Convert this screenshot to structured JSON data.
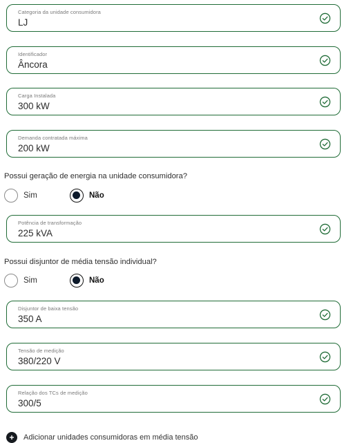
{
  "fields": [
    {
      "label": "Categoria da unidade consumidora",
      "value": "LJ"
    },
    {
      "label": "Identificador",
      "value": "Âncora"
    },
    {
      "label": "Carga Instalada",
      "value": "300 kW"
    },
    {
      "label": "Demanda contratada máxima",
      "value": "200 kW"
    },
    {
      "label": "Potência de transformação",
      "value": "225 kVA"
    },
    {
      "label": "Disjuntor de baixa tensão",
      "value": "350 A"
    },
    {
      "label": "Tensão de medição",
      "value": "380/220 V"
    },
    {
      "label": "Relação dos TCs de medição",
      "value": "300/5"
    }
  ],
  "question_generation": {
    "text": "Possui geração de energia na unidade consumidora?",
    "options": [
      "Sim",
      "Não"
    ],
    "selected": "Não"
  },
  "question_breaker": {
    "text": "Possui disjuntor de média tensão individual?",
    "options": [
      "Sim",
      "Não"
    ],
    "selected": "Não"
  },
  "add_action": {
    "icon": "plus-icon",
    "label": "Adicionar unidades consumidoras em média tensão"
  },
  "colors": {
    "field_border": "#1f6b36",
    "check": "#1f6b36",
    "radio_selected": "#0d1a2b"
  }
}
